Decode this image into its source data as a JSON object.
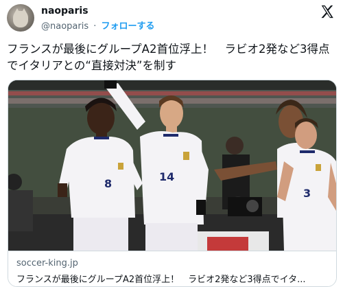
{
  "author": {
    "display_name": "naoparis",
    "handle": "@naoparis",
    "separator": "·",
    "follow_label": "フォローする",
    "avatar_icon": "cat-avatar-icon"
  },
  "platform": {
    "logo_icon": "x-logo-icon"
  },
  "tweet": {
    "text": "フランスが最後にグループA2首位浮上！　ラビオ2発など3得点でイタリアとの“直接対決”を制す"
  },
  "card": {
    "image_icon": "soccer-players-celebration-photo",
    "jersey_numbers": [
      "8",
      "14",
      "3"
    ],
    "domain": "soccer-king.jp",
    "title": "フランスが最後にグループA2首位浮上！　ラビオ2発など3得点でイタ..."
  },
  "colors": {
    "link": "#1d9bf0",
    "secondary_text": "#536471",
    "primary_text": "#0f1419",
    "border": "#cfd9de",
    "jersey": "#f4f3f6",
    "jersey_trim": "#1e2a6b"
  }
}
